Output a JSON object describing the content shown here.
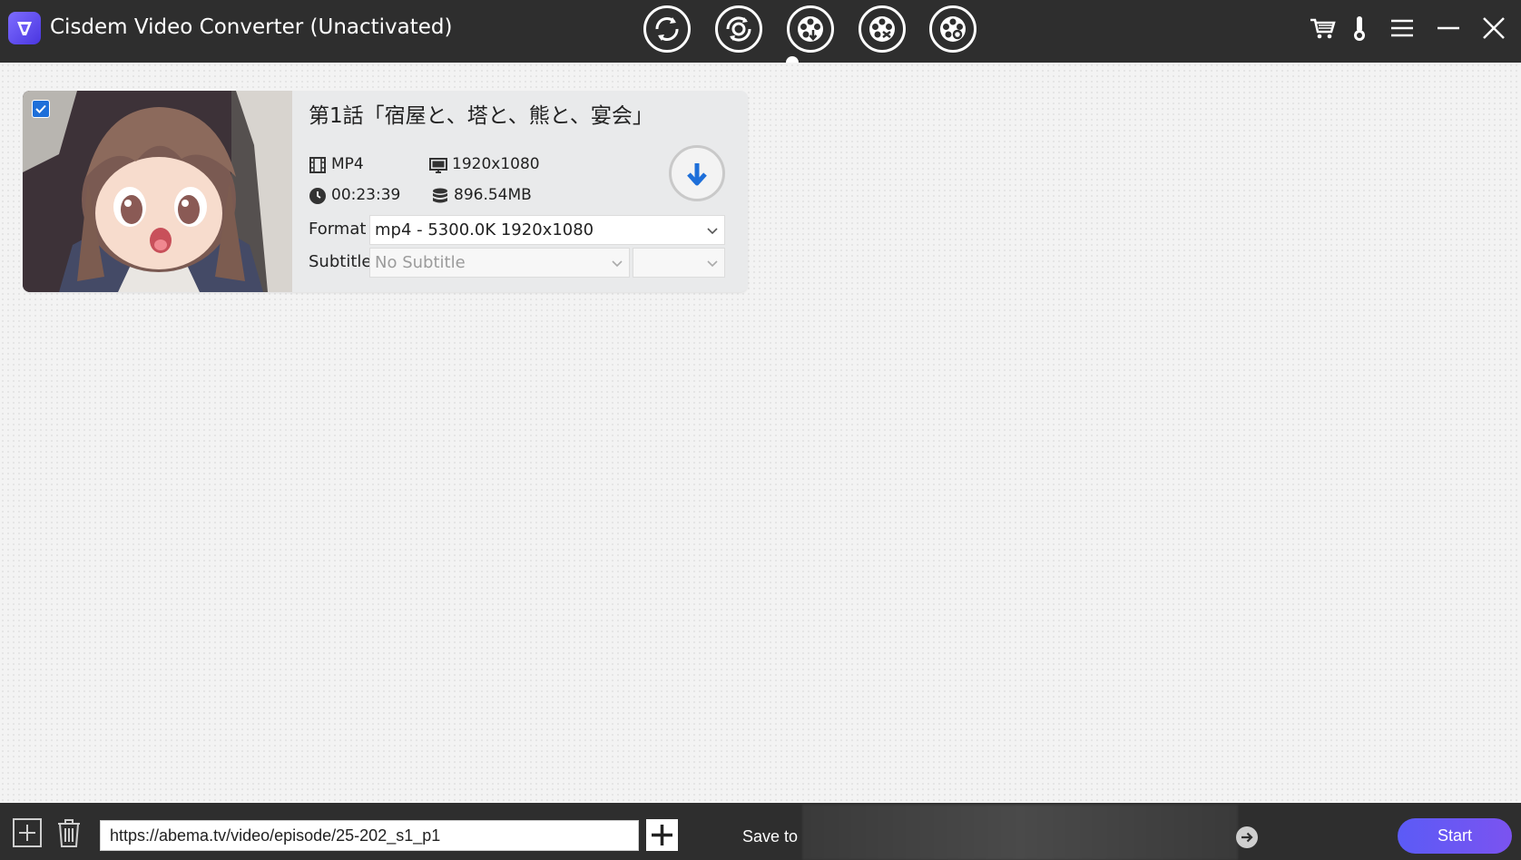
{
  "window": {
    "title": "Cisdem Video Converter (Unactivated)",
    "logo_icon": "app-logo-icon"
  },
  "toolbar": {
    "modes": [
      {
        "name": "convert-mode-button",
        "icon": "convert-icon"
      },
      {
        "name": "rip-mode-button",
        "icon": "rip-dvd-icon"
      },
      {
        "name": "download-mode-button",
        "icon": "film-reel-download-icon",
        "active": true
      },
      {
        "name": "edit-mode-button",
        "icon": "film-reel-edit-icon"
      },
      {
        "name": "burn-mode-button",
        "icon": "film-reel-burn-icon"
      }
    ],
    "window_controls": [
      "cart-icon",
      "thermometer-icon",
      "menu-icon",
      "minimize-icon",
      "close-icon"
    ]
  },
  "video": {
    "checked": true,
    "title": "第1話「宿屋と、塔と、熊と、宴会」",
    "format": "MP4",
    "resolution": "1920x1080",
    "duration": "00:23:39",
    "size": "896.54MB",
    "format_label": "Format",
    "format_value": "mp4 - 5300.0K 1920x1080",
    "subtitle_label": "Subtitle",
    "subtitle_value": "No Subtitle",
    "subtitle_lang_value": ""
  },
  "bottom": {
    "url_value": "https://abema.tv/video/episode/25-202_s1_p1",
    "save_to_label": "Save to",
    "start_label": "Start"
  },
  "colors": {
    "titlebar_bg": "#2e2e2e",
    "accent_blue": "#1e6fd9",
    "start_gradient_from": "#5b5bf6",
    "start_gradient_to": "#7b53f0"
  }
}
